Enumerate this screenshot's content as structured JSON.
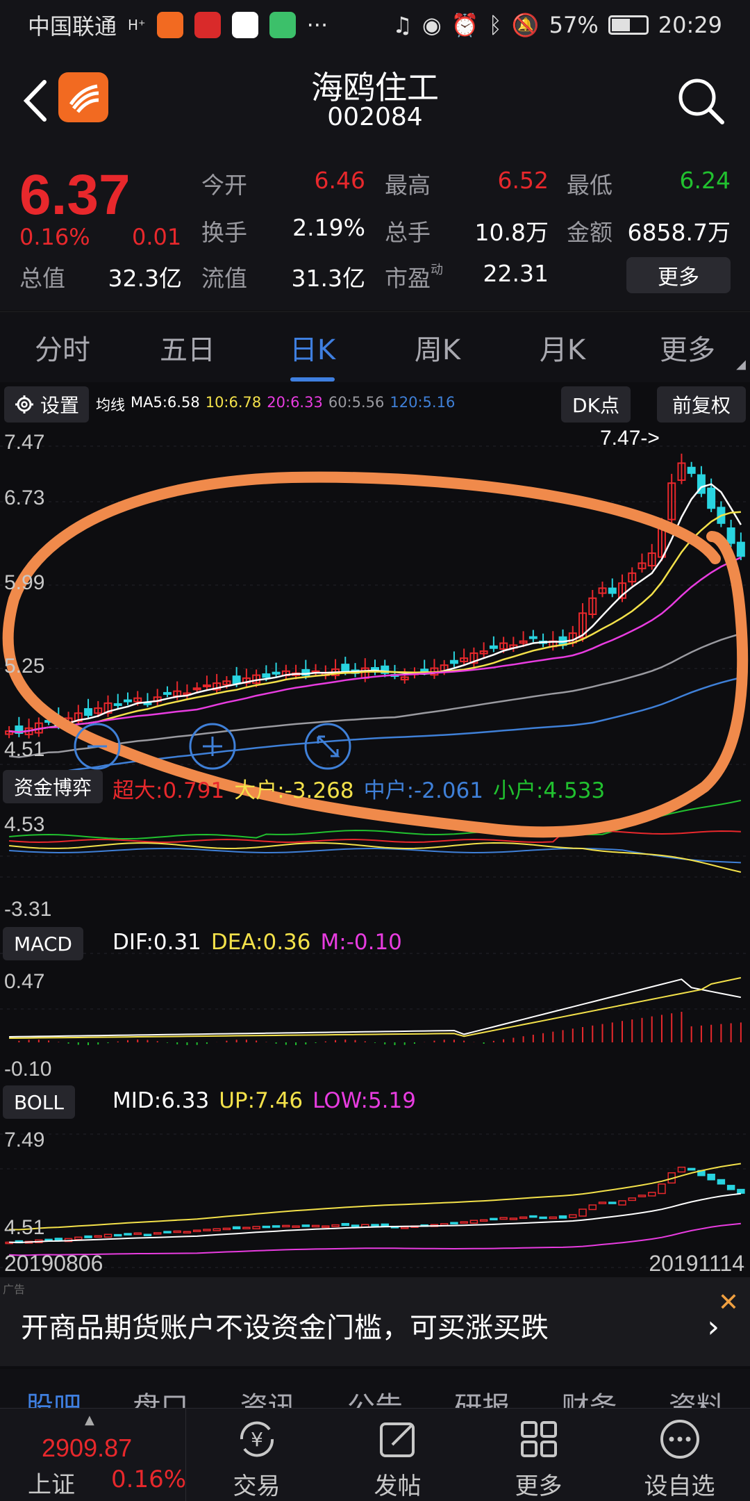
{
  "statusbar": {
    "carrier": "中国联通",
    "signal": "H⁺",
    "battery": "57%",
    "time": "20:29"
  },
  "header": {
    "stock_name": "海鸥住工",
    "stock_code": "002084"
  },
  "quote": {
    "price": "6.37",
    "change_pct": "0.16%",
    "change": "0.01",
    "rows": [
      [
        {
          "label": "今开",
          "value": "6.46",
          "color": "#e8282c"
        },
        {
          "label": "最高",
          "value": "6.52",
          "color": "#e8282c"
        },
        {
          "label": "最低",
          "value": "6.24",
          "color": "#21c12f"
        }
      ],
      [
        {
          "label": "换手",
          "value": "2.19%",
          "color": "#ffffff"
        },
        {
          "label": "总手",
          "value": "10.8万",
          "color": "#ffffff"
        },
        {
          "label": "金额",
          "value": "6858.7万",
          "color": "#ffffff"
        }
      ],
      [
        {
          "label": "总值",
          "value": "32.3亿",
          "color": "#ffffff"
        },
        {
          "label": "流值",
          "value": "31.3亿",
          "color": "#ffffff"
        },
        {
          "label": "市盈",
          "sup": "动",
          "value": "22.31",
          "color": "#ffffff"
        }
      ]
    ],
    "more": "更多"
  },
  "tabs": [
    "分时",
    "五日",
    "日K",
    "周K",
    "月K",
    "更多"
  ],
  "active_tab": 2,
  "chart_toolbar": {
    "settings": "设置",
    "ma_label": "均线",
    "ma": [
      {
        "text": "MA5:6.58",
        "color": "#ffffff"
      },
      {
        "text": "10:6.78",
        "color": "#f3e14a"
      },
      {
        "text": "20:6.33",
        "color": "#e83ce0"
      },
      {
        "text": "60:5.56",
        "color": "#9a9aa0"
      },
      {
        "text": "120:5.16",
        "color": "#3f80d8"
      }
    ],
    "dk": "DK点",
    "fq": "前复权"
  },
  "kline_axis": [
    "7.47",
    "6.73",
    "5.99",
    "5.25",
    "4.51"
  ],
  "kline_marker": "7.47->",
  "fund_panel": {
    "label": "资金博弈",
    "items": [
      {
        "text": "超大:0.791",
        "color": "#e8282c"
      },
      {
        "text": "大户:-3.268",
        "color": "#f3e14a"
      },
      {
        "text": "中户:-2.061",
        "color": "#3f80d8"
      },
      {
        "text": "小户:4.533",
        "color": "#21c12f"
      }
    ],
    "axis": [
      "4.53",
      "-3.31"
    ]
  },
  "macd_panel": {
    "label": "MACD",
    "items": [
      {
        "text": "DIF:0.31",
        "color": "#ffffff"
      },
      {
        "text": "DEA:0.36",
        "color": "#f3e14a"
      },
      {
        "text": "M:-0.10",
        "color": "#e83ce0"
      }
    ],
    "axis": [
      "0.47",
      "-0.10"
    ]
  },
  "boll_panel": {
    "label": "BOLL",
    "items": [
      {
        "text": "MID:6.33",
        "color": "#ffffff"
      },
      {
        "text": "UP:7.46",
        "color": "#f3e14a"
      },
      {
        "text": "LOW:5.19",
        "color": "#e83ce0"
      }
    ],
    "axis": [
      "7.49",
      "4.51"
    ]
  },
  "dates": {
    "start": "20190806",
    "end": "20191114"
  },
  "ad": {
    "tag": "广告",
    "text": "开商品期货账户不设资金门槛，可买涨买跌"
  },
  "subtabs": [
    "股吧",
    "盘口",
    "资讯",
    "公告",
    "研报",
    "财务",
    "资料"
  ],
  "bottom": {
    "index_value": "2909.87",
    "index_name": "上证",
    "index_pct": "0.16%",
    "buttons": [
      "交易",
      "发帖",
      "更多",
      "设自选"
    ]
  },
  "chart_data": {
    "type": "candlestick",
    "title": "日K",
    "x_range": [
      "20190806",
      "20191114"
    ],
    "ylim": [
      4.51,
      7.47
    ],
    "max_marker": 7.47,
    "close_approx": [
      4.62,
      4.6,
      4.65,
      4.7,
      4.72,
      4.68,
      4.75,
      4.8,
      4.78,
      4.85,
      4.9,
      4.88,
      4.92,
      4.95,
      4.9,
      4.96,
      5.0,
      5.02,
      5.0,
      5.05,
      5.08,
      5.1,
      5.12,
      5.1,
      5.15,
      5.18,
      5.16,
      5.2,
      5.22,
      5.2,
      5.18,
      5.22,
      5.2,
      5.24,
      5.22,
      5.2,
      5.25,
      5.22,
      5.2,
      5.18,
      5.16,
      5.2,
      5.22,
      5.25,
      5.28,
      5.3,
      5.35,
      5.4,
      5.42,
      5.45,
      5.5,
      5.48,
      5.52,
      5.55,
      5.5,
      5.52,
      5.48,
      5.6,
      5.8,
      5.95,
      6.05,
      6.0,
      6.1,
      6.2,
      6.3,
      6.4,
      6.7,
      7.1,
      7.3,
      7.2,
      7.0,
      6.85,
      6.7,
      6.5,
      6.37
    ]
  }
}
